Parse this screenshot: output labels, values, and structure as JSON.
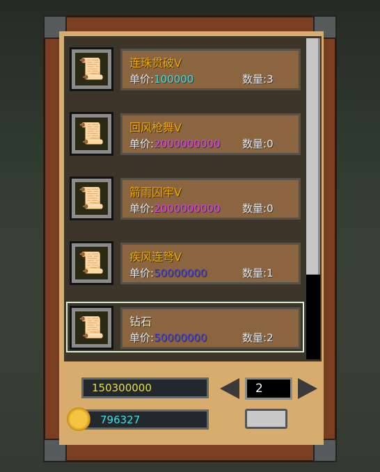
{
  "items": [
    {
      "name": "连珠贯破V",
      "price_label": "单价:",
      "price": "100000",
      "price_color": "#3fdede",
      "qty_label": "数量:",
      "qty": "3",
      "icon": "scroll-icon"
    },
    {
      "name": "回风枪舞V",
      "price_label": "单价:",
      "price": "2000000000",
      "price_color": "#e040e8",
      "qty_label": "数量:",
      "qty": "0",
      "icon": "scroll-icon"
    },
    {
      "name": "箭雨囚牢V",
      "price_label": "单价:",
      "price": "2000000000",
      "price_color": "#e040e8",
      "qty_label": "数量:",
      "qty": "0",
      "icon": "scroll-icon"
    },
    {
      "name": "疾风连弩V",
      "price_label": "单价:",
      "price": "50000000",
      "price_color": "#3f3fe0",
      "qty_label": "数量:",
      "qty": "1",
      "icon": "scroll-icon"
    },
    {
      "name": "钻石",
      "price_label": "单价:",
      "price": "50000000",
      "price_color": "#3f3fe0",
      "qty_label": "数量:",
      "qty": "2",
      "icon": "scroll-icon",
      "selected": true
    }
  ],
  "footer": {
    "total": "150300000",
    "total_color": "#e8e040",
    "coins": "796327",
    "coins_color": "#40e0e8",
    "page": "2"
  }
}
